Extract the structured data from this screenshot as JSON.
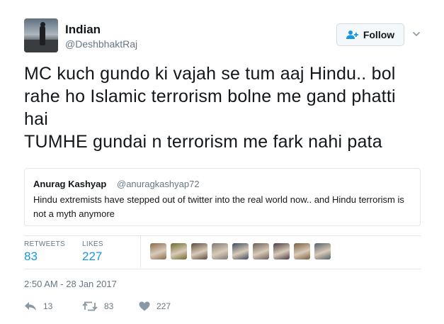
{
  "author": {
    "display_name": "Indian",
    "handle": "@DeshbhaktRaj",
    "avatar_icon": "avatar-photo-man-on-beach"
  },
  "follow": {
    "label": "Follow",
    "icon": "add-user-icon"
  },
  "tweet": {
    "text": "MC kuch gundo ki vajah se tum aaj Hindu.. bol\nrahe ho Islamic terrorism bolne me gand phatti\nhai\nTUMHE gundai n terrorism me fark nahi pata"
  },
  "quoted_tweet": {
    "display_name": "Anurag Kashyap",
    "handle": "@anuragkashyap72",
    "text": "Hindu extremists have stepped out of twitter into the real world now.. and  Hindu terrorism is not a myth anymore"
  },
  "stats": {
    "retweets_label": "RETWEETS",
    "retweets_value": "83",
    "likes_label": "LIKES",
    "likes_value": "227",
    "liker_avatar_colors": [
      "#8a6a4f",
      "#6f6a2c",
      "#5b4a3c",
      "#7f7a75",
      "#3d4d5f",
      "#6b5e55",
      "#4d3b45",
      "#7a5f3e",
      "#55606a"
    ]
  },
  "timestamp": "2:50 AM - 28 Jan 2017",
  "actions": {
    "reply_count": "13",
    "retweet_count": "83",
    "like_count": "227"
  },
  "colors": {
    "accent": "#1b95e0",
    "secondary_text": "#657786",
    "border": "#e1e8ed"
  }
}
